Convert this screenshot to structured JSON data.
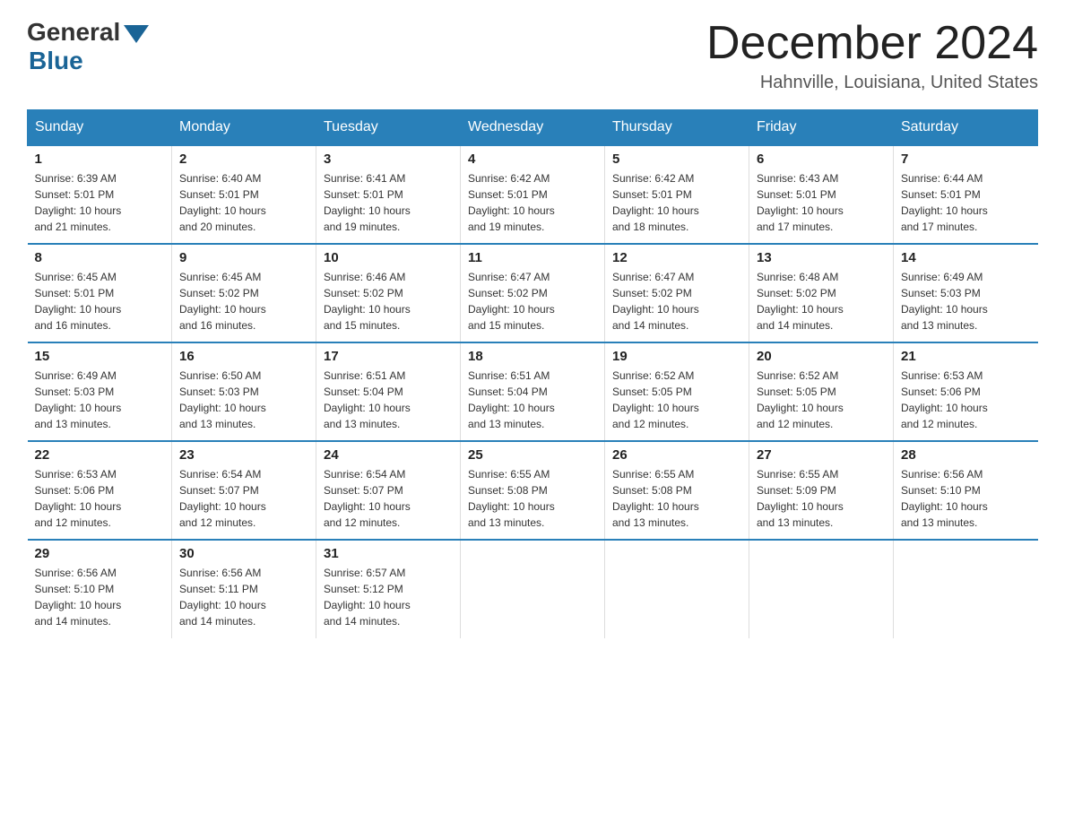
{
  "header": {
    "logo_general": "General",
    "logo_blue": "Blue",
    "month_title": "December 2024",
    "location": "Hahnville, Louisiana, United States"
  },
  "days_of_week": [
    "Sunday",
    "Monday",
    "Tuesday",
    "Wednesday",
    "Thursday",
    "Friday",
    "Saturday"
  ],
  "weeks": [
    [
      {
        "day": "1",
        "sunrise": "6:39 AM",
        "sunset": "5:01 PM",
        "daylight": "10 hours and 21 minutes."
      },
      {
        "day": "2",
        "sunrise": "6:40 AM",
        "sunset": "5:01 PM",
        "daylight": "10 hours and 20 minutes."
      },
      {
        "day": "3",
        "sunrise": "6:41 AM",
        "sunset": "5:01 PM",
        "daylight": "10 hours and 19 minutes."
      },
      {
        "day": "4",
        "sunrise": "6:42 AM",
        "sunset": "5:01 PM",
        "daylight": "10 hours and 19 minutes."
      },
      {
        "day": "5",
        "sunrise": "6:42 AM",
        "sunset": "5:01 PM",
        "daylight": "10 hours and 18 minutes."
      },
      {
        "day": "6",
        "sunrise": "6:43 AM",
        "sunset": "5:01 PM",
        "daylight": "10 hours and 17 minutes."
      },
      {
        "day": "7",
        "sunrise": "6:44 AM",
        "sunset": "5:01 PM",
        "daylight": "10 hours and 17 minutes."
      }
    ],
    [
      {
        "day": "8",
        "sunrise": "6:45 AM",
        "sunset": "5:01 PM",
        "daylight": "10 hours and 16 minutes."
      },
      {
        "day": "9",
        "sunrise": "6:45 AM",
        "sunset": "5:02 PM",
        "daylight": "10 hours and 16 minutes."
      },
      {
        "day": "10",
        "sunrise": "6:46 AM",
        "sunset": "5:02 PM",
        "daylight": "10 hours and 15 minutes."
      },
      {
        "day": "11",
        "sunrise": "6:47 AM",
        "sunset": "5:02 PM",
        "daylight": "10 hours and 15 minutes."
      },
      {
        "day": "12",
        "sunrise": "6:47 AM",
        "sunset": "5:02 PM",
        "daylight": "10 hours and 14 minutes."
      },
      {
        "day": "13",
        "sunrise": "6:48 AM",
        "sunset": "5:02 PM",
        "daylight": "10 hours and 14 minutes."
      },
      {
        "day": "14",
        "sunrise": "6:49 AM",
        "sunset": "5:03 PM",
        "daylight": "10 hours and 13 minutes."
      }
    ],
    [
      {
        "day": "15",
        "sunrise": "6:49 AM",
        "sunset": "5:03 PM",
        "daylight": "10 hours and 13 minutes."
      },
      {
        "day": "16",
        "sunrise": "6:50 AM",
        "sunset": "5:03 PM",
        "daylight": "10 hours and 13 minutes."
      },
      {
        "day": "17",
        "sunrise": "6:51 AM",
        "sunset": "5:04 PM",
        "daylight": "10 hours and 13 minutes."
      },
      {
        "day": "18",
        "sunrise": "6:51 AM",
        "sunset": "5:04 PM",
        "daylight": "10 hours and 13 minutes."
      },
      {
        "day": "19",
        "sunrise": "6:52 AM",
        "sunset": "5:05 PM",
        "daylight": "10 hours and 12 minutes."
      },
      {
        "day": "20",
        "sunrise": "6:52 AM",
        "sunset": "5:05 PM",
        "daylight": "10 hours and 12 minutes."
      },
      {
        "day": "21",
        "sunrise": "6:53 AM",
        "sunset": "5:06 PM",
        "daylight": "10 hours and 12 minutes."
      }
    ],
    [
      {
        "day": "22",
        "sunrise": "6:53 AM",
        "sunset": "5:06 PM",
        "daylight": "10 hours and 12 minutes."
      },
      {
        "day": "23",
        "sunrise": "6:54 AM",
        "sunset": "5:07 PM",
        "daylight": "10 hours and 12 minutes."
      },
      {
        "day": "24",
        "sunrise": "6:54 AM",
        "sunset": "5:07 PM",
        "daylight": "10 hours and 12 minutes."
      },
      {
        "day": "25",
        "sunrise": "6:55 AM",
        "sunset": "5:08 PM",
        "daylight": "10 hours and 13 minutes."
      },
      {
        "day": "26",
        "sunrise": "6:55 AM",
        "sunset": "5:08 PM",
        "daylight": "10 hours and 13 minutes."
      },
      {
        "day": "27",
        "sunrise": "6:55 AM",
        "sunset": "5:09 PM",
        "daylight": "10 hours and 13 minutes."
      },
      {
        "day": "28",
        "sunrise": "6:56 AM",
        "sunset": "5:10 PM",
        "daylight": "10 hours and 13 minutes."
      }
    ],
    [
      {
        "day": "29",
        "sunrise": "6:56 AM",
        "sunset": "5:10 PM",
        "daylight": "10 hours and 14 minutes."
      },
      {
        "day": "30",
        "sunrise": "6:56 AM",
        "sunset": "5:11 PM",
        "daylight": "10 hours and 14 minutes."
      },
      {
        "day": "31",
        "sunrise": "6:57 AM",
        "sunset": "5:12 PM",
        "daylight": "10 hours and 14 minutes."
      },
      null,
      null,
      null,
      null
    ]
  ],
  "labels": {
    "sunrise": "Sunrise:",
    "sunset": "Sunset:",
    "daylight": "Daylight:"
  }
}
